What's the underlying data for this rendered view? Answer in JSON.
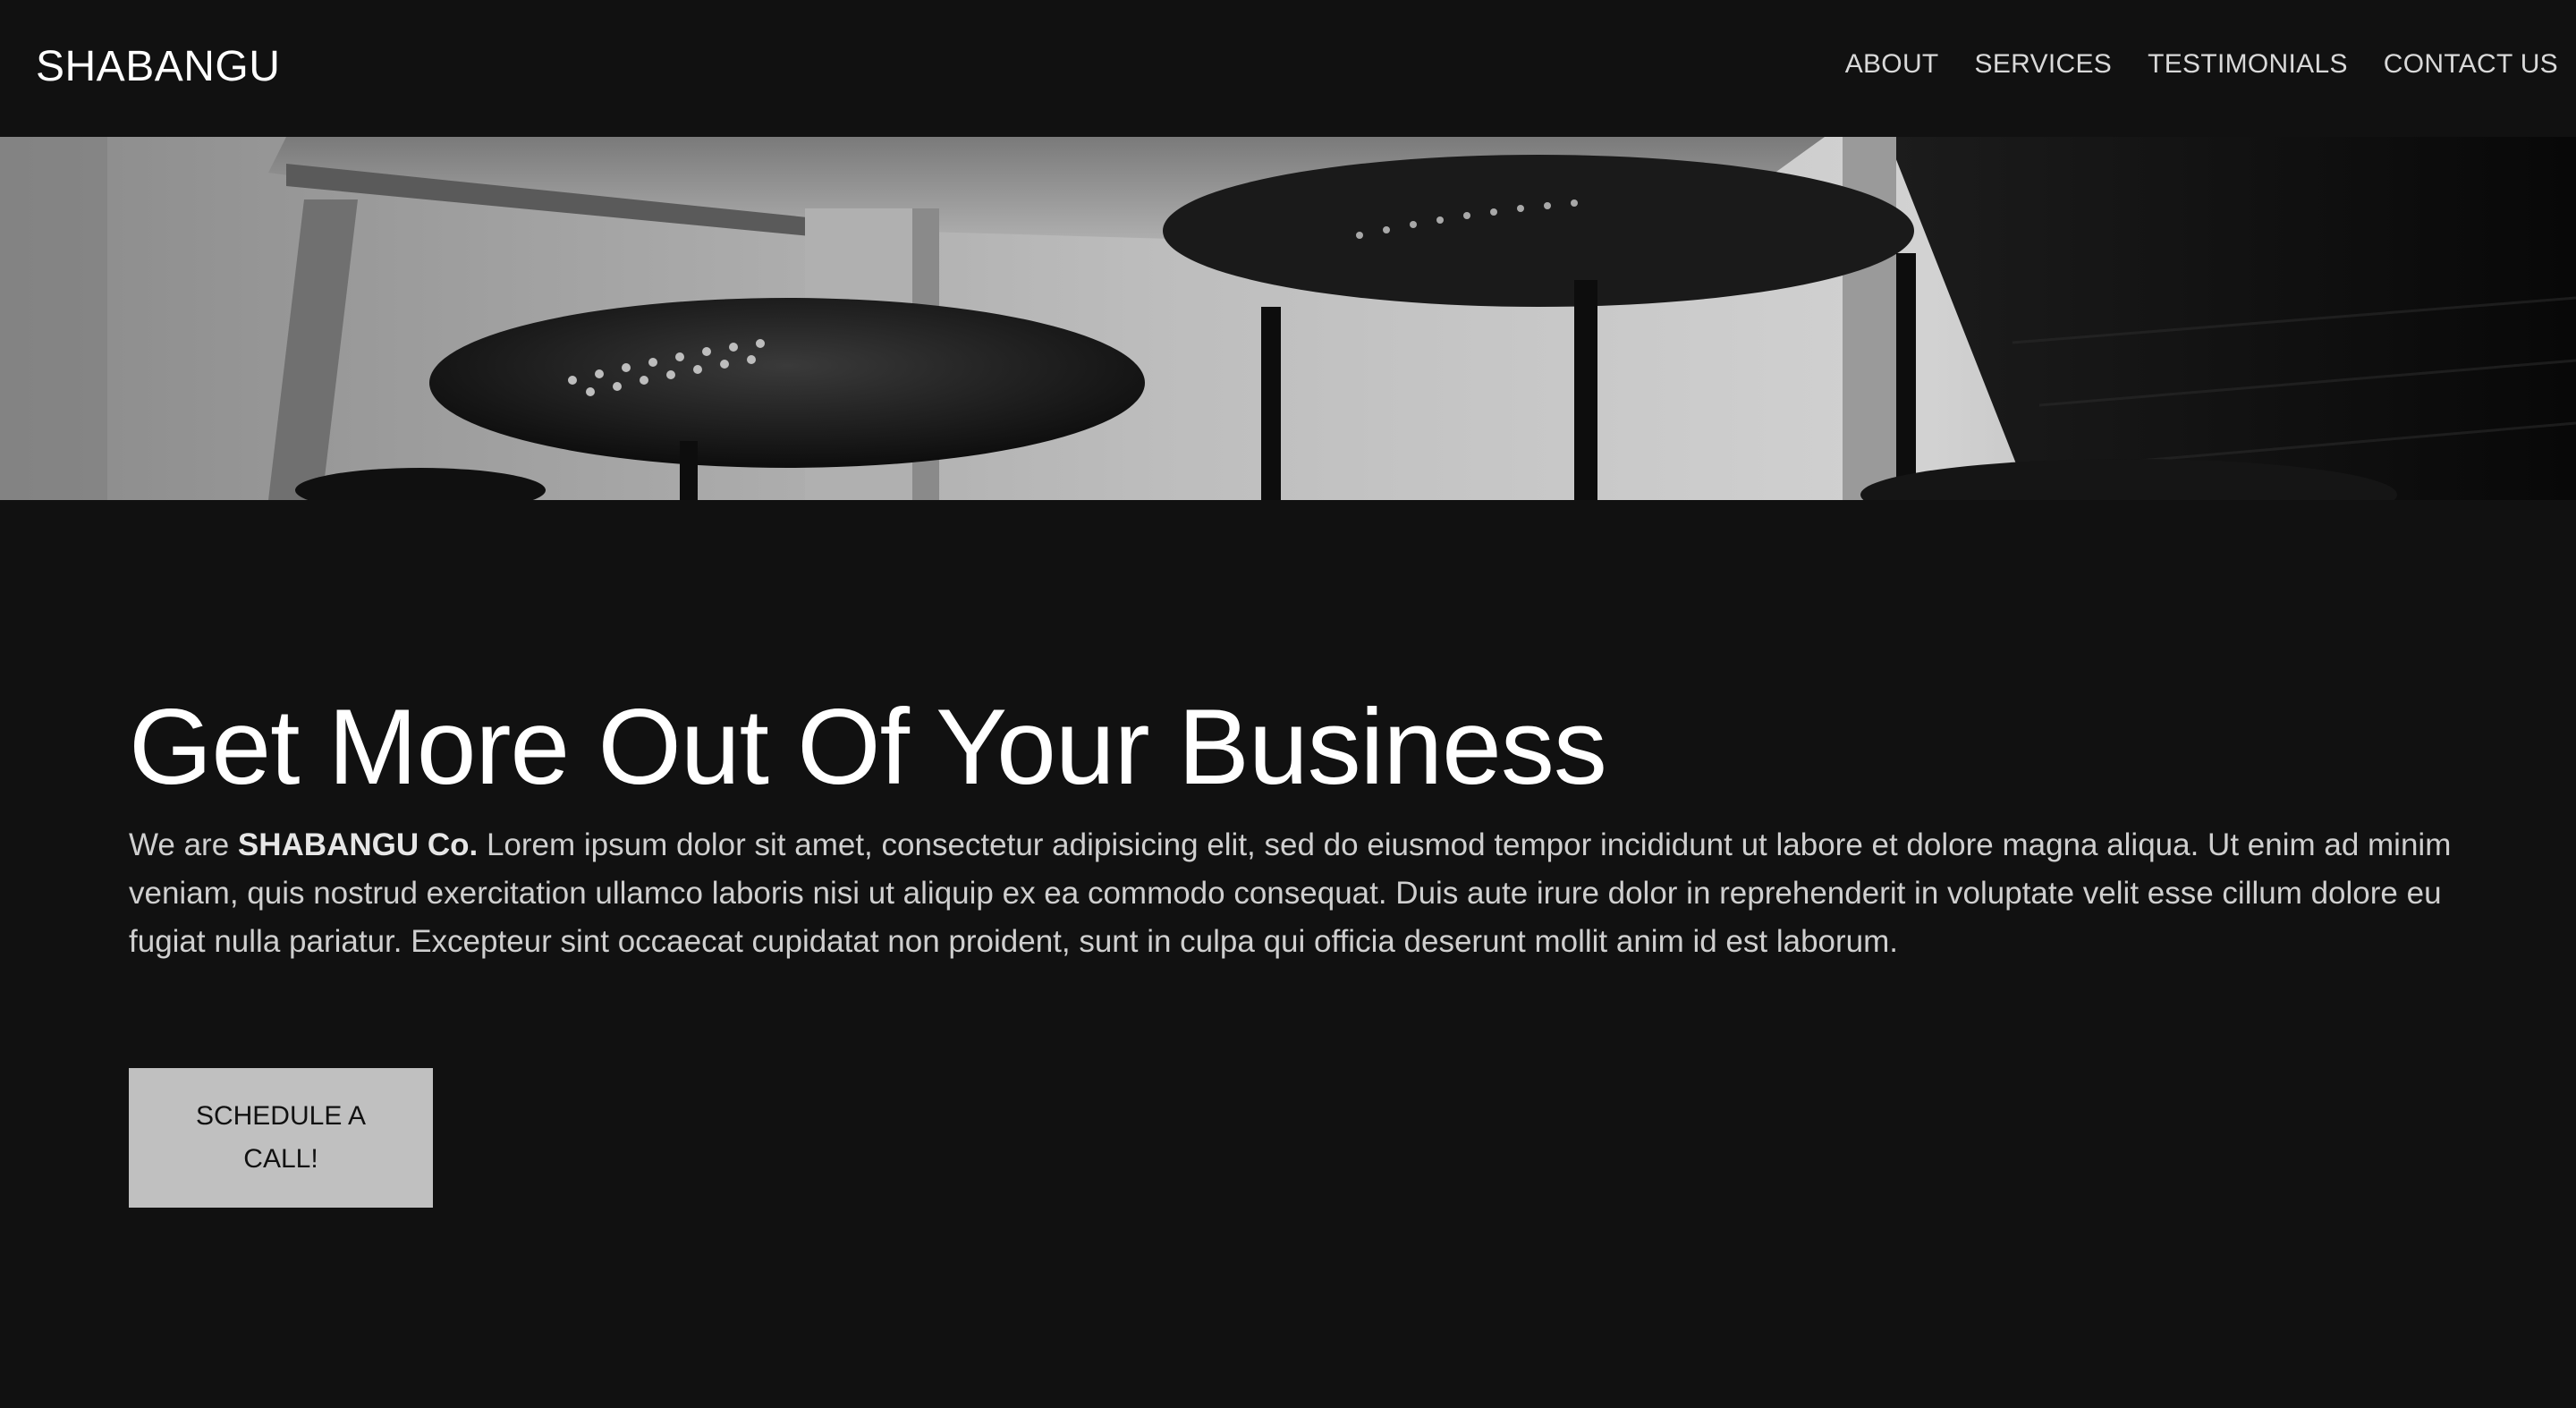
{
  "nav": {
    "brand": "SHABANGU",
    "links": [
      "ABOUT",
      "SERVICES",
      "TESTIMONIALS",
      "CONTACT US"
    ]
  },
  "hero": {
    "image": "black-and-white-chairs-table-photo"
  },
  "main": {
    "headline": "Get More Out Of Your Business",
    "intro_prefix": "We are ",
    "intro_company": "SHABANGU Co.",
    "intro_body": " Lorem ipsum dolor sit amet, consectetur adipisicing elit, sed do eiusmod tempor incididunt ut labore et dolore magna aliqua. Ut enim ad minim veniam, quis nostrud exercitation ullamco laboris nisi ut aliquip ex ea commodo consequat. Duis aute irure dolor in reprehenderit in voluptate velit esse cillum dolore eu fugiat nulla pariatur. Excepteur sint occaecat cupidatat non proident, sunt in culpa qui officia deserunt mollit anim id est laborum.",
    "cta_label": "SCHEDULE A CALL!"
  },
  "colors": {
    "background": "#111111",
    "text_primary": "#ffffff",
    "text_body": "#cfcfcf",
    "nav_link": "#d9d9d9",
    "button_bg": "#c0c0c0",
    "button_text": "#111111"
  }
}
